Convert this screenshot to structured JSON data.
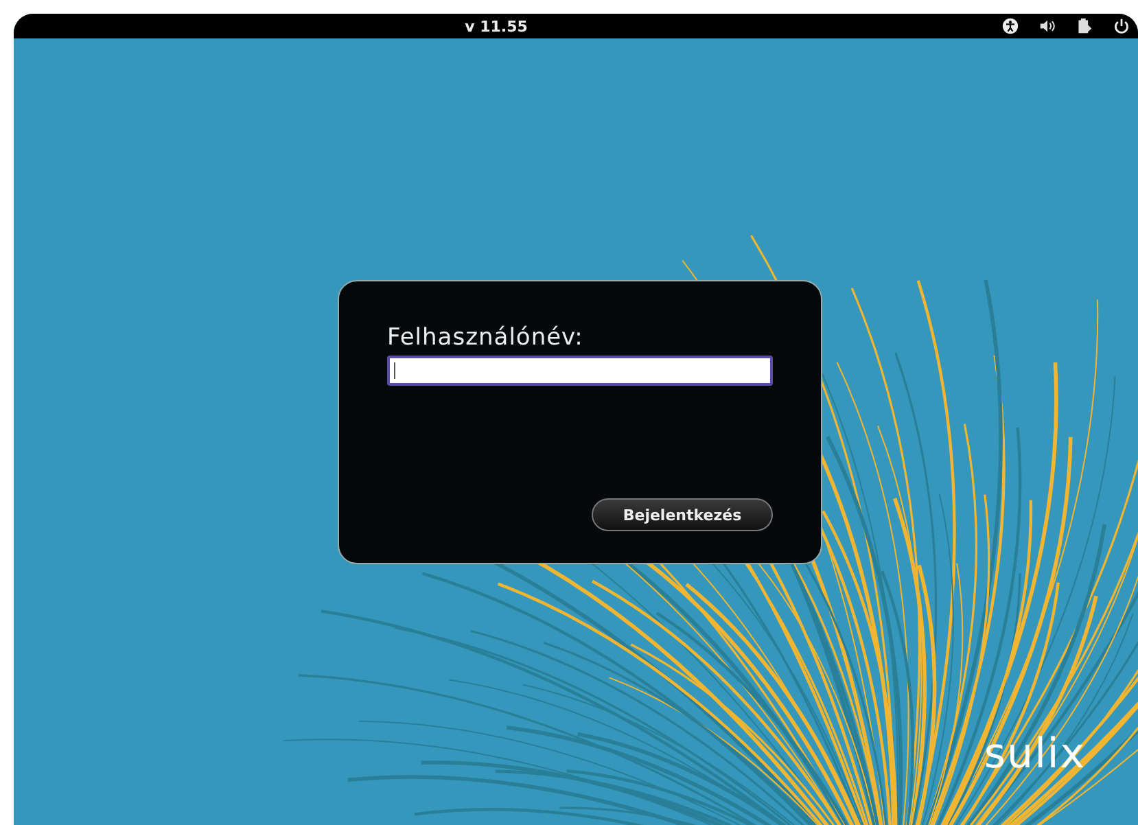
{
  "top_bar": {
    "version": "v 11.55"
  },
  "login": {
    "label": "Felhasználónév:",
    "button": "Bejelentkezés"
  },
  "logo": {
    "text": "sulix"
  }
}
